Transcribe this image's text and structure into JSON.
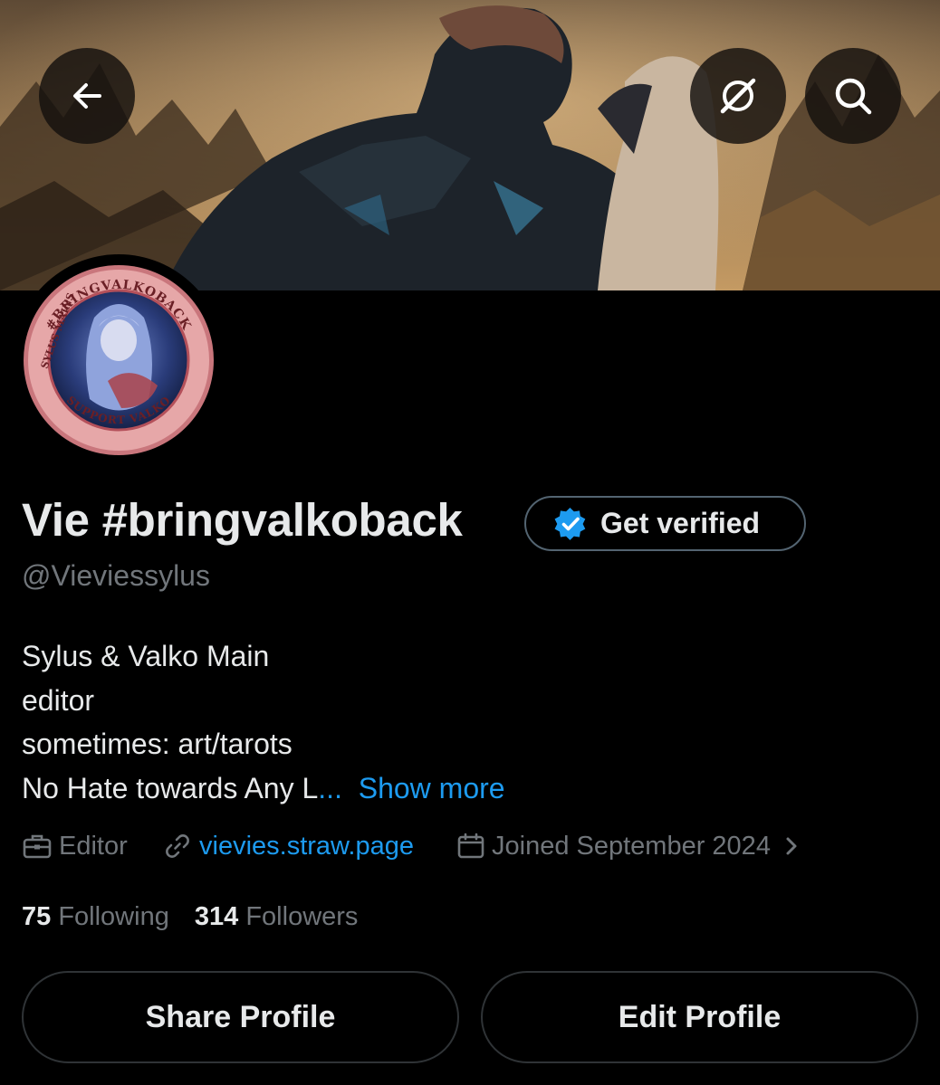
{
  "header": {
    "back_icon": "arrow-left-icon",
    "grok_icon": "grok-icon",
    "search_icon": "search-icon"
  },
  "avatar": {
    "ring_text_top": "#BRINGVALKOBACK",
    "ring_text_left": "SYLUS MAINS",
    "ring_text_bottom": "SUPPORT VALKO"
  },
  "profile": {
    "display_name": "Vie #bringvalkoback",
    "handle": "@Vieviessylus",
    "get_verified_label": "Get verified",
    "verified_badge_color": "#1d9bf0"
  },
  "bio": {
    "lines": [
      "Sylus & Valko Main",
      "editor",
      "sometimes: art/tarots"
    ],
    "truncated_line": "No Hate towards Any L",
    "ellipsis": "...",
    "show_more": "Show more"
  },
  "meta": {
    "profession": "Editor",
    "profession_icon": "briefcase-icon",
    "website": "vievies.straw.page",
    "website_icon": "link-icon",
    "joined": "Joined September 2024",
    "joined_icon": "calendar-icon",
    "chevron_icon": "chevron-right-icon"
  },
  "stats": {
    "following_count": "75",
    "following_label": "Following",
    "followers_count": "314",
    "followers_label": "Followers"
  },
  "actions": {
    "share_label": "Share Profile",
    "edit_label": "Edit Profile"
  },
  "colors": {
    "background": "#000000",
    "text_primary": "#e7e9ea",
    "text_secondary": "#71767b",
    "accent": "#1d9bf0",
    "border": "#2f3336"
  }
}
